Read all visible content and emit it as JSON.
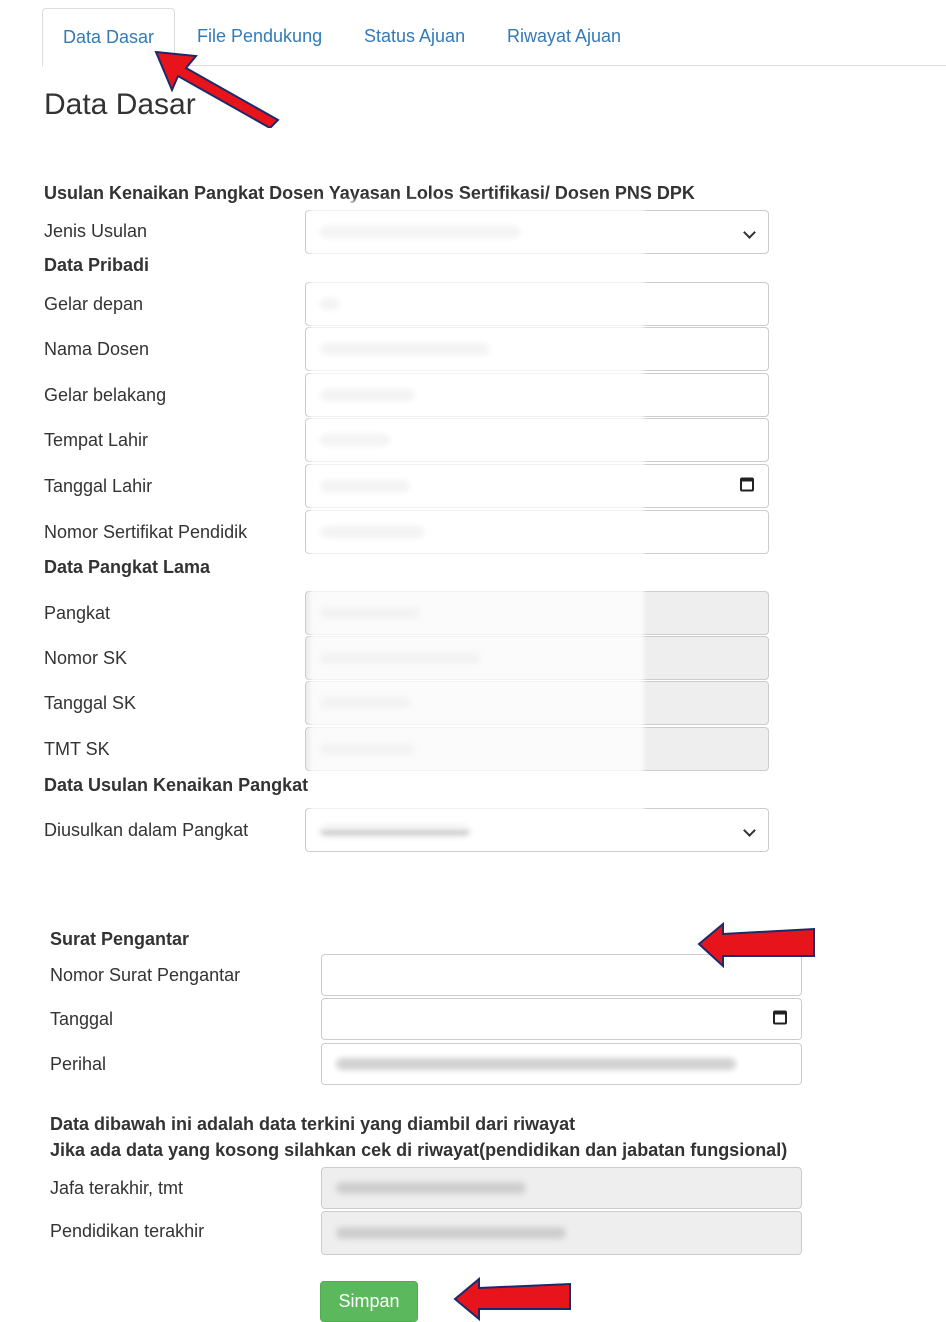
{
  "tabs": [
    {
      "label": "Data Dasar",
      "active": true
    },
    {
      "label": "File Pendukung"
    },
    {
      "label": "Status Ajuan"
    },
    {
      "label": "Riwayat Ajuan"
    }
  ],
  "page_title": "Data Dasar",
  "form": {
    "heading": "Usulan Kenaikan Pangkat Dosen Yayasan Lolos Sertifikasi/ Dosen PNS DPK",
    "jenis_usulan": {
      "label": "Jenis Usulan"
    },
    "data_pribadi": {
      "heading": "Data Pribadi",
      "gelar_depan": "Gelar depan",
      "nama_dosen": "Nama Dosen",
      "gelar_belakang": "Gelar belakang",
      "tempat_lahir": "Tempat Lahir",
      "tanggal_lahir": "Tanggal Lahir",
      "nomor_sertifikat": "Nomor Sertifikat Pendidik"
    },
    "data_pangkat_lama": {
      "heading": "Data Pangkat Lama",
      "pangkat": "Pangkat",
      "nomor_sk": "Nomor SK",
      "tanggal_sk": "Tanggal SK",
      "tmt_sk": "TMT SK"
    },
    "data_usulan": {
      "heading": "Data Usulan Kenaikan Pangkat",
      "diusulkan": "Diusulkan dalam Pangkat"
    },
    "surat_pengantar": {
      "heading": "Surat Pengantar",
      "nomor": "Nomor Surat Pengantar",
      "tanggal": "Tanggal",
      "perihal": "Perihal"
    },
    "info": {
      "line1": "Data dibawah ini adalah data terkini yang diambil dari riwayat",
      "line2": "Jika ada data yang kosong silahkan cek di riwayat(pendidikan dan jabatan fungsional)",
      "jafa": "Jafa terakhir, tmt",
      "pendidikan": "Pendidikan terakhir"
    },
    "submit_label": "Simpan"
  },
  "colors": {
    "link": "#337ab7",
    "submit": "#5cb85c",
    "arrow": "#e8141b"
  },
  "icons": [
    "calendar-icon",
    "chevron-down-icon",
    "red-arrow-annotation"
  ]
}
